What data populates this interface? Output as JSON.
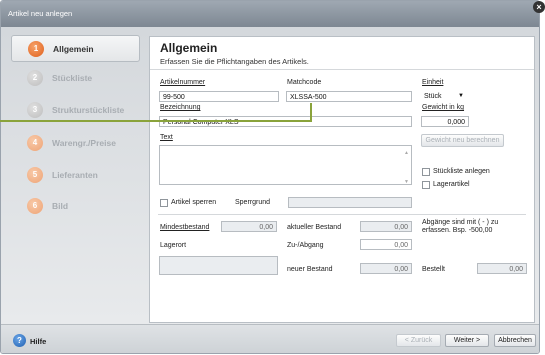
{
  "window": {
    "title": "Artikel neu anlegen"
  },
  "sidebar": {
    "items": [
      {
        "num": "1",
        "label": "Allgemein"
      },
      {
        "num": "2",
        "label": "Stückliste"
      },
      {
        "num": "3",
        "label": "Strukturstückliste"
      },
      {
        "num": "4",
        "label": "Warengr./Preise"
      },
      {
        "num": "5",
        "label": "Lieferanten"
      },
      {
        "num": "6",
        "label": "Bild"
      }
    ]
  },
  "panel": {
    "title": "Allgemein",
    "subtitle": "Erfassen Sie die Pflichtangaben des Artikels."
  },
  "form": {
    "artikelnummer_label": "Artikelnummer",
    "artikelnummer_value": "99-500",
    "matchcode_label": "Matchcode",
    "matchcode_value": "XLSSA-500",
    "einheit_label": "Einheit",
    "einheit_value": "Stück",
    "bezeichnung_label": "Bezeichnung",
    "bezeichnung_value": "Personal Computer XLS",
    "gewicht_label": "Gewicht in kg",
    "gewicht_value": "0,000",
    "gewicht_button": "Gewicht neu berechnen",
    "text_label": "Text",
    "stueckliste_anlegen": "Stückliste anlegen",
    "lagerartikel": "Lagerartikel",
    "artikel_sperren": "Artikel sperren",
    "sperrgrund_label": "Sperrgrund",
    "mindestbestand_label": "Mindestbestand",
    "mindestbestand_value": "0,00",
    "aktueller_bestand_label": "aktueller Bestand",
    "aktueller_bestand_value": "0,00",
    "abgaenge_note": "Abgänge sind mit ( - ) zu erfassen. Bsp. -500,00",
    "lagerort_label": "Lagerort",
    "zu_abgang_label": "Zu-/Abgang",
    "zu_abgang_value": "0,00",
    "neuer_bestand_label": "neuer Bestand",
    "neuer_bestand_value": "0,00",
    "bestellt_label": "Bestellt",
    "bestellt_value": "0,00"
  },
  "footer": {
    "help_label": "Hilfe",
    "back_button": "< Zurück",
    "next_button": "Weiter >",
    "cancel_button": "Abbrechen"
  },
  "colors": {
    "accent": "#e0601c",
    "callout": "#8aa33b",
    "titlebar": "#8a939d"
  }
}
